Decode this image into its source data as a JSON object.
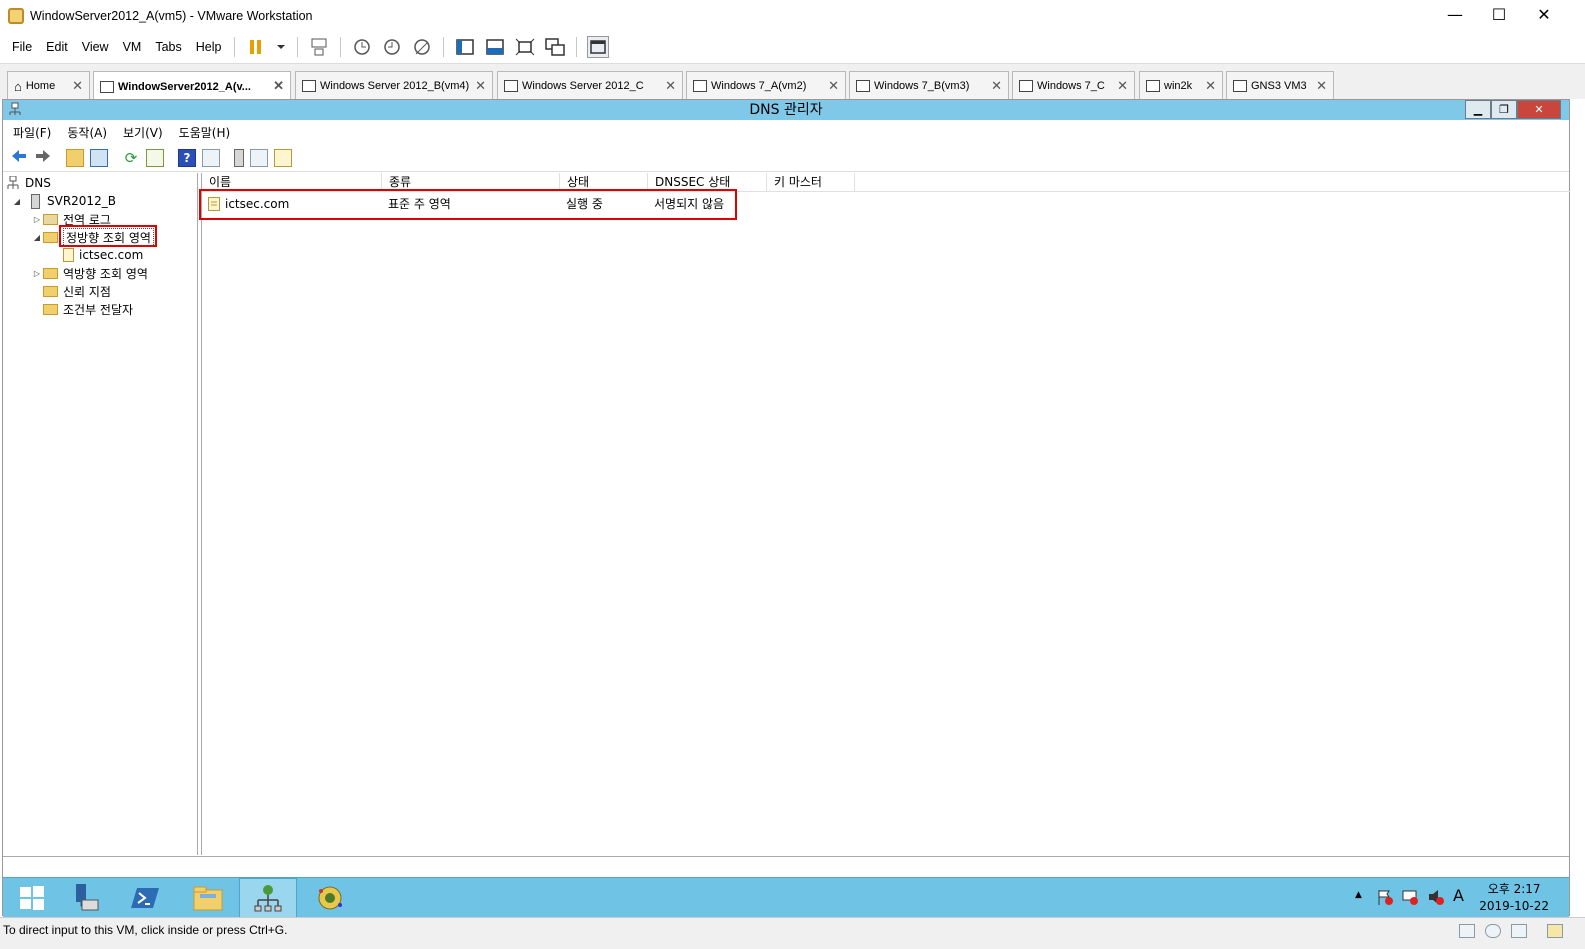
{
  "vmware": {
    "title": "WindowServer2012_A(vm5) - VMware Workstation",
    "menu": [
      "File",
      "Edit",
      "View",
      "VM",
      "Tabs",
      "Help"
    ],
    "tabs": [
      {
        "label": "Home"
      },
      {
        "label": "WindowServer2012_A(v..."
      },
      {
        "label": "Windows Server 2012_B(vm4)"
      },
      {
        "label": "Windows Server 2012_C"
      },
      {
        "label": "Windows 7_A(vm2)"
      },
      {
        "label": "Windows 7_B(vm3)"
      },
      {
        "label": "Windows 7_C"
      },
      {
        "label": "win2k"
      },
      {
        "label": "GNS3 VM3"
      }
    ],
    "status_text": "To direct input to this VM, click inside or press Ctrl+G."
  },
  "mmc": {
    "title": "DNS 관리자",
    "menu": [
      "파일(F)",
      "동작(A)",
      "보기(V)",
      "도움말(H)"
    ],
    "tree": {
      "root": "DNS",
      "server": "SVR2012_B",
      "global_log": "전역 로그",
      "forward_zones": "정방향 조회 영역",
      "zone": "ictsec.com",
      "reverse_zones": "역방향 조회 영역",
      "trust_points": "신뢰 지점",
      "conditional_forwarders": "조건부 전달자"
    },
    "columns": [
      "이름",
      "종류",
      "상태",
      "DNSSEC 상태",
      "키 마스터"
    ],
    "rows": [
      {
        "name": "ictsec.com",
        "type": "표준 주 영역",
        "status": "실행 중",
        "dnssec": "서명되지 않음",
        "key_master": ""
      }
    ]
  },
  "taskbar": {
    "ime": "A",
    "time": "오후 2:17",
    "date": "2019-10-22"
  },
  "colors": {
    "highlight_box": "#e00000",
    "mmc_title_bg": "#7fc8e8",
    "taskbar_bg": "#6fc4e6"
  }
}
